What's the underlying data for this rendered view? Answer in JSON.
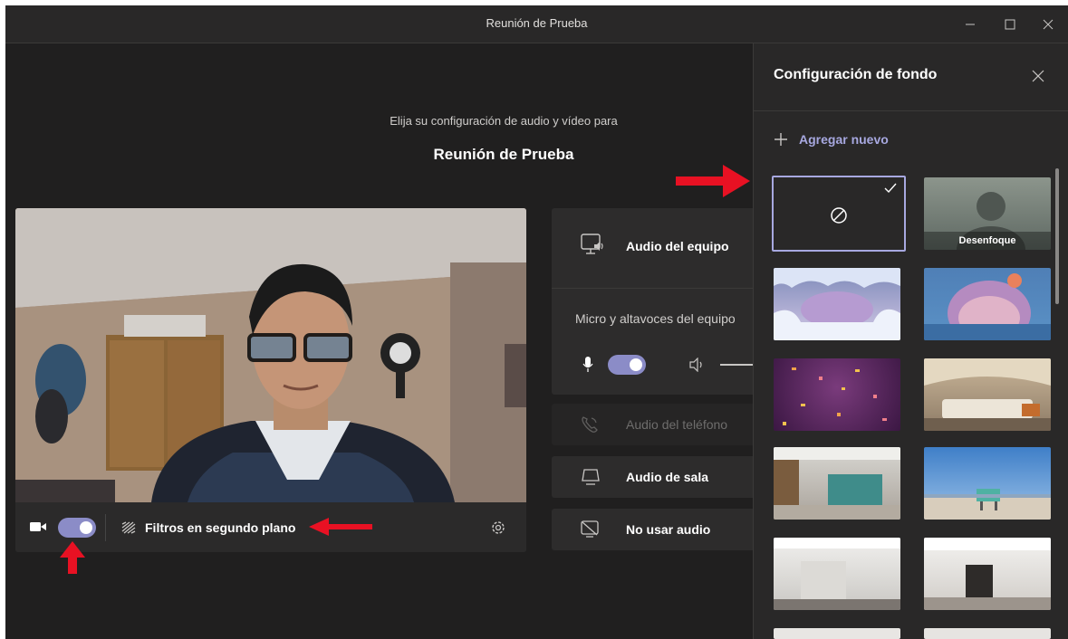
{
  "window": {
    "title": "Reunión de Prueba",
    "minimize_icon": "minimize-icon",
    "maximize_icon": "maximize-icon",
    "close_icon": "close-icon"
  },
  "prejoin": {
    "prompt": "Elija su configuración de audio y vídeo para",
    "meeting_name": "Reunión de Prueba"
  },
  "video_controls": {
    "camera_icon": "camera-icon",
    "camera_toggle_on": true,
    "filters_label": "Filtros en segundo plano",
    "settings_icon": "gear-icon"
  },
  "audio_options": {
    "computer": {
      "label": "Audio del equipo",
      "device_text": "Micro y altavoces del equipo",
      "mic_toggle_on": true
    },
    "phone": {
      "label": "Audio del teléfono"
    },
    "room": {
      "label": "Audio de sala"
    },
    "none": {
      "label": "No usar audio"
    }
  },
  "background_panel": {
    "title": "Configuración de fondo",
    "add_new": "Agregar nuevo",
    "thumbnails": [
      {
        "name": "none",
        "selected": true
      },
      {
        "name": "blur",
        "label": "Desenfoque"
      },
      {
        "name": "ice-cave"
      },
      {
        "name": "fantasy-arch"
      },
      {
        "name": "confetti"
      },
      {
        "name": "cozy-bedroom"
      },
      {
        "name": "office-lockers"
      },
      {
        "name": "beach-lifeguard"
      },
      {
        "name": "white-room"
      },
      {
        "name": "white-loft"
      }
    ]
  },
  "colors": {
    "accent": "#8b8cc7",
    "arrow": "#e81123",
    "background": "#201f1f"
  }
}
